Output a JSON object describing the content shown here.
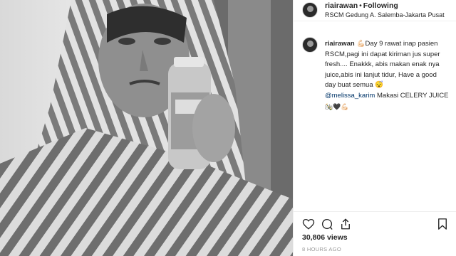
{
  "post": {
    "username": "riairawan",
    "follow_state": "Following",
    "location": "RSCM Gedung A. Salemba-Jakarta Pusat",
    "caption_lines": [
      "💪🏻Day 9 rawat inap pasien",
      "RSCM,pagi ini dapat kiriman jus super",
      "fresh.... Enakkk, abis makan enak nya",
      "juice,abis ini lanjut tidur, Have a good",
      "day buat semua 😴"
    ],
    "mention": "@melissa_karim",
    "mention_suffix": " Makasi CELERY JUICE",
    "caption_emoji_line": "🍾🖤💪🏻",
    "time_ago": "8h",
    "likes": "30,806 views",
    "posted_ago": "8 HOURS AGO"
  },
  "icons": {
    "like": "heart-icon",
    "comment": "comment-icon",
    "share": "share-icon",
    "save": "bookmark-icon"
  },
  "colors": {
    "mention": "#003569",
    "muted": "#999999"
  }
}
